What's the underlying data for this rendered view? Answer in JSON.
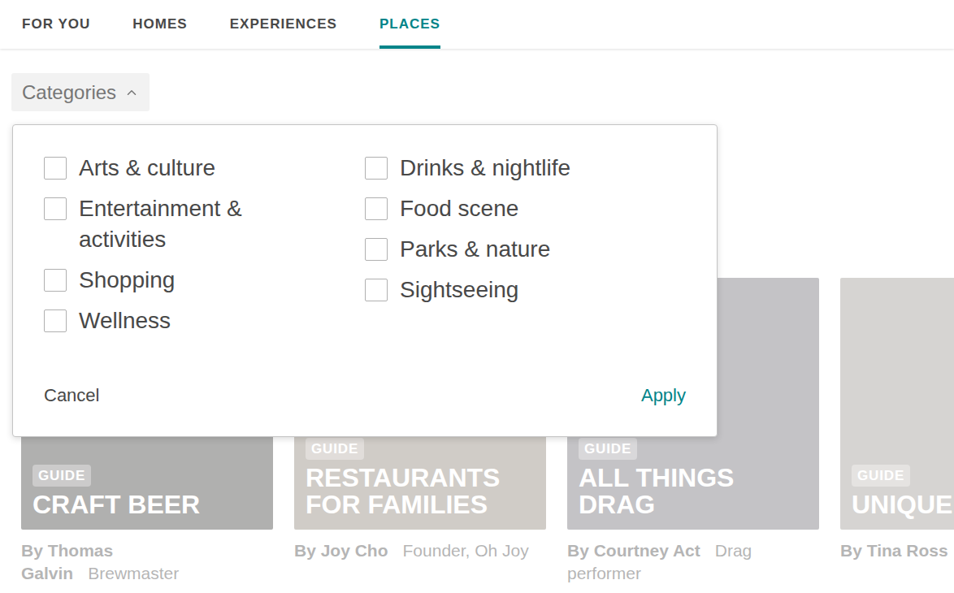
{
  "nav": {
    "tabs": [
      {
        "label": "FOR YOU",
        "selected": false
      },
      {
        "label": "HOMES",
        "selected": false
      },
      {
        "label": "EXPERIENCES",
        "selected": false
      },
      {
        "label": "PLACES",
        "selected": true
      }
    ]
  },
  "filter_button": {
    "label": "Categories",
    "expanded": true
  },
  "categories_menu": {
    "columns": [
      [
        {
          "label": "Arts & culture",
          "checked": false
        },
        {
          "label": "Entertainment & activities",
          "checked": false
        },
        {
          "label": "Shopping",
          "checked": false
        },
        {
          "label": "Wellness",
          "checked": false
        }
      ],
      [
        {
          "label": "Drinks & nightlife",
          "checked": false
        },
        {
          "label": "Food scene",
          "checked": false
        },
        {
          "label": "Parks & nature",
          "checked": false
        },
        {
          "label": "Sightseeing",
          "checked": false
        }
      ]
    ],
    "cancel": "Cancel",
    "apply": "Apply"
  },
  "guides": [
    {
      "badge": "GUIDE",
      "title": "CRAFT BEER",
      "author": "By Thomas Galvin",
      "role": "Brewmaster",
      "color": "#3b3a38"
    },
    {
      "badge": "GUIDE",
      "title": "RESTAURANTS FOR FAMILIES",
      "author": "By Joy Cho",
      "role": "Founder, Oh Joy",
      "color": "#8a7f74"
    },
    {
      "badge": "GUIDE",
      "title": "ALL THINGS DRAG",
      "author": "By Courtney Act",
      "role": "Drag performer",
      "color": "#6d6a70"
    },
    {
      "badge": "GUIDE",
      "title": "UNIQUE",
      "author": "By Tina Ross",
      "role": "",
      "color": "#9a958e"
    }
  ]
}
